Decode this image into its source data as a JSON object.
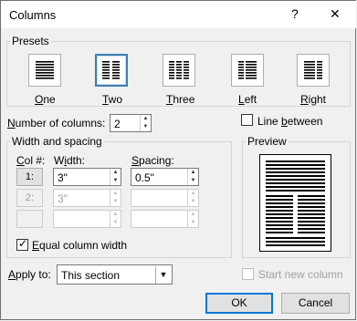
{
  "window": {
    "title": "Columns",
    "help": "?",
    "close": "✕"
  },
  "presets": {
    "label": "Presets",
    "items": [
      {
        "label": "One"
      },
      {
        "label": "Two"
      },
      {
        "label": "Three"
      },
      {
        "label": "Left"
      },
      {
        "label": "Right"
      }
    ],
    "selected": "Two"
  },
  "number_of_columns": {
    "label": "Number of columns:",
    "value": "2"
  },
  "line_between": {
    "label": "Line between",
    "checked": false
  },
  "width_spacing": {
    "label": "Width and spacing",
    "col_header": "Col #:",
    "width_header": "Width:",
    "spacing_header": "Spacing:",
    "rows": [
      {
        "col": "1:",
        "width": "3\"",
        "spacing": "0.5\"",
        "enabled": true
      },
      {
        "col": "2:",
        "width": "3\"",
        "spacing": "",
        "enabled": false
      },
      {
        "col": "",
        "width": "",
        "spacing": "",
        "enabled": false
      }
    ],
    "equal_width": {
      "label": "Equal column width",
      "checked": true
    }
  },
  "preview": {
    "label": "Preview"
  },
  "apply_to": {
    "label": "Apply to:",
    "value": "This section"
  },
  "start_new_column": {
    "label": "Start new column",
    "checked": false,
    "enabled": false
  },
  "buttons": {
    "ok": "OK",
    "cancel": "Cancel"
  },
  "colors": {
    "accent": "#0078d7",
    "selected_border": "#3c7fb1"
  }
}
